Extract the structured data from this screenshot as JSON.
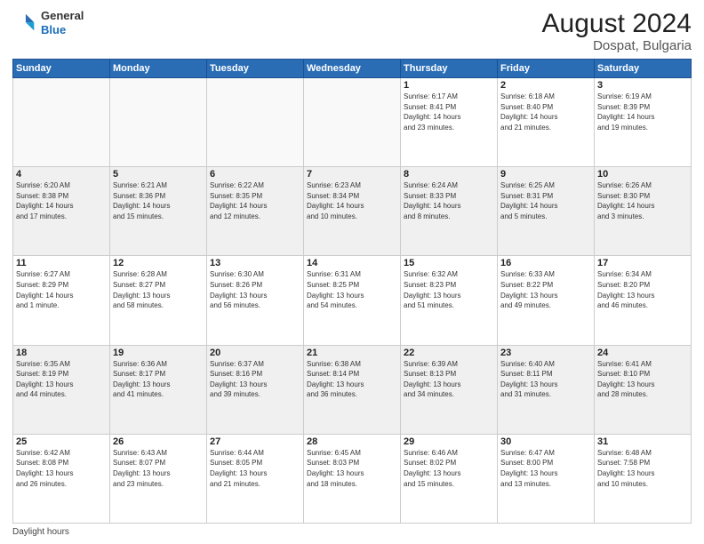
{
  "header": {
    "logo_general": "General",
    "logo_blue": "Blue",
    "month_year": "August 2024",
    "location": "Dospat, Bulgaria"
  },
  "footer": {
    "label": "Daylight hours"
  },
  "weekdays": [
    "Sunday",
    "Monday",
    "Tuesday",
    "Wednesday",
    "Thursday",
    "Friday",
    "Saturday"
  ],
  "weeks": [
    [
      {
        "day": "",
        "info": ""
      },
      {
        "day": "",
        "info": ""
      },
      {
        "day": "",
        "info": ""
      },
      {
        "day": "",
        "info": ""
      },
      {
        "day": "1",
        "info": "Sunrise: 6:17 AM\nSunset: 8:41 PM\nDaylight: 14 hours\nand 23 minutes."
      },
      {
        "day": "2",
        "info": "Sunrise: 6:18 AM\nSunset: 8:40 PM\nDaylight: 14 hours\nand 21 minutes."
      },
      {
        "day": "3",
        "info": "Sunrise: 6:19 AM\nSunset: 8:39 PM\nDaylight: 14 hours\nand 19 minutes."
      }
    ],
    [
      {
        "day": "4",
        "info": "Sunrise: 6:20 AM\nSunset: 8:38 PM\nDaylight: 14 hours\nand 17 minutes."
      },
      {
        "day": "5",
        "info": "Sunrise: 6:21 AM\nSunset: 8:36 PM\nDaylight: 14 hours\nand 15 minutes."
      },
      {
        "day": "6",
        "info": "Sunrise: 6:22 AM\nSunset: 8:35 PM\nDaylight: 14 hours\nand 12 minutes."
      },
      {
        "day": "7",
        "info": "Sunrise: 6:23 AM\nSunset: 8:34 PM\nDaylight: 14 hours\nand 10 minutes."
      },
      {
        "day": "8",
        "info": "Sunrise: 6:24 AM\nSunset: 8:33 PM\nDaylight: 14 hours\nand 8 minutes."
      },
      {
        "day": "9",
        "info": "Sunrise: 6:25 AM\nSunset: 8:31 PM\nDaylight: 14 hours\nand 5 minutes."
      },
      {
        "day": "10",
        "info": "Sunrise: 6:26 AM\nSunset: 8:30 PM\nDaylight: 14 hours\nand 3 minutes."
      }
    ],
    [
      {
        "day": "11",
        "info": "Sunrise: 6:27 AM\nSunset: 8:29 PM\nDaylight: 14 hours\nand 1 minute."
      },
      {
        "day": "12",
        "info": "Sunrise: 6:28 AM\nSunset: 8:27 PM\nDaylight: 13 hours\nand 58 minutes."
      },
      {
        "day": "13",
        "info": "Sunrise: 6:30 AM\nSunset: 8:26 PM\nDaylight: 13 hours\nand 56 minutes."
      },
      {
        "day": "14",
        "info": "Sunrise: 6:31 AM\nSunset: 8:25 PM\nDaylight: 13 hours\nand 54 minutes."
      },
      {
        "day": "15",
        "info": "Sunrise: 6:32 AM\nSunset: 8:23 PM\nDaylight: 13 hours\nand 51 minutes."
      },
      {
        "day": "16",
        "info": "Sunrise: 6:33 AM\nSunset: 8:22 PM\nDaylight: 13 hours\nand 49 minutes."
      },
      {
        "day": "17",
        "info": "Sunrise: 6:34 AM\nSunset: 8:20 PM\nDaylight: 13 hours\nand 46 minutes."
      }
    ],
    [
      {
        "day": "18",
        "info": "Sunrise: 6:35 AM\nSunset: 8:19 PM\nDaylight: 13 hours\nand 44 minutes."
      },
      {
        "day": "19",
        "info": "Sunrise: 6:36 AM\nSunset: 8:17 PM\nDaylight: 13 hours\nand 41 minutes."
      },
      {
        "day": "20",
        "info": "Sunrise: 6:37 AM\nSunset: 8:16 PM\nDaylight: 13 hours\nand 39 minutes."
      },
      {
        "day": "21",
        "info": "Sunrise: 6:38 AM\nSunset: 8:14 PM\nDaylight: 13 hours\nand 36 minutes."
      },
      {
        "day": "22",
        "info": "Sunrise: 6:39 AM\nSunset: 8:13 PM\nDaylight: 13 hours\nand 34 minutes."
      },
      {
        "day": "23",
        "info": "Sunrise: 6:40 AM\nSunset: 8:11 PM\nDaylight: 13 hours\nand 31 minutes."
      },
      {
        "day": "24",
        "info": "Sunrise: 6:41 AM\nSunset: 8:10 PM\nDaylight: 13 hours\nand 28 minutes."
      }
    ],
    [
      {
        "day": "25",
        "info": "Sunrise: 6:42 AM\nSunset: 8:08 PM\nDaylight: 13 hours\nand 26 minutes."
      },
      {
        "day": "26",
        "info": "Sunrise: 6:43 AM\nSunset: 8:07 PM\nDaylight: 13 hours\nand 23 minutes."
      },
      {
        "day": "27",
        "info": "Sunrise: 6:44 AM\nSunset: 8:05 PM\nDaylight: 13 hours\nand 21 minutes."
      },
      {
        "day": "28",
        "info": "Sunrise: 6:45 AM\nSunset: 8:03 PM\nDaylight: 13 hours\nand 18 minutes."
      },
      {
        "day": "29",
        "info": "Sunrise: 6:46 AM\nSunset: 8:02 PM\nDaylight: 13 hours\nand 15 minutes."
      },
      {
        "day": "30",
        "info": "Sunrise: 6:47 AM\nSunset: 8:00 PM\nDaylight: 13 hours\nand 13 minutes."
      },
      {
        "day": "31",
        "info": "Sunrise: 6:48 AM\nSunset: 7:58 PM\nDaylight: 13 hours\nand 10 minutes."
      }
    ]
  ]
}
